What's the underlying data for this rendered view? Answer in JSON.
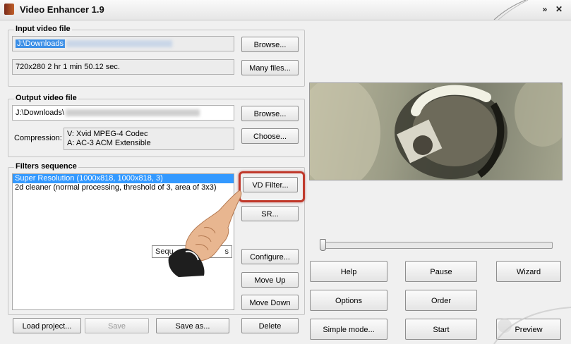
{
  "window": {
    "title": "Video Enhancer 1.9"
  },
  "input_group": {
    "label": "Input video file",
    "path": "J:\\Downloads",
    "info": "720x280 2 hr 1 min 50.12 sec.",
    "browse_label": "Browse...",
    "many_files_label": "Many files..."
  },
  "output_group": {
    "label": "Output video file",
    "path": "J:\\Downloads\\",
    "browse_label": "Browse...",
    "compression_label": "Compression:",
    "video_codec": "V: Xvid MPEG-4 Codec",
    "audio_codec": "A: AC-3 ACM Extensible",
    "choose_label": "Choose..."
  },
  "filters_group": {
    "label": "Filters sequence",
    "items": [
      "Super Resolution (1000x818, 1000x818, 3)",
      "2d cleaner (normal processing, threshold of 3, area of 3x3)"
    ],
    "selected_index": 0,
    "tooltip_start": "Sequ",
    "tooltip_end": "s"
  },
  "filter_buttons": {
    "vd_filter": "VD Filter...",
    "sr": "SR...",
    "configure": "Configure...",
    "move_up": "Move Up",
    "move_down": "Move Down",
    "delete": "Delete"
  },
  "bottom_buttons": {
    "load_project": "Load project...",
    "save": "Save",
    "save_as": "Save as..."
  },
  "right_panel": {
    "slider_position": 0.0,
    "buttons": {
      "help": "Help",
      "pause": "Pause",
      "wizard": "Wizard",
      "options": "Options",
      "order": "Order",
      "simple_mode": "Simple mode...",
      "start": "Start",
      "preview": "Preview"
    }
  },
  "colors": {
    "selection": "#3399ff",
    "highlight_ring": "#c0392b",
    "background": "#f0f0f0"
  },
  "icons": [
    "app-icon",
    "minimize-chevrons-icon",
    "close-icon",
    "pointing-hand-icon"
  ]
}
